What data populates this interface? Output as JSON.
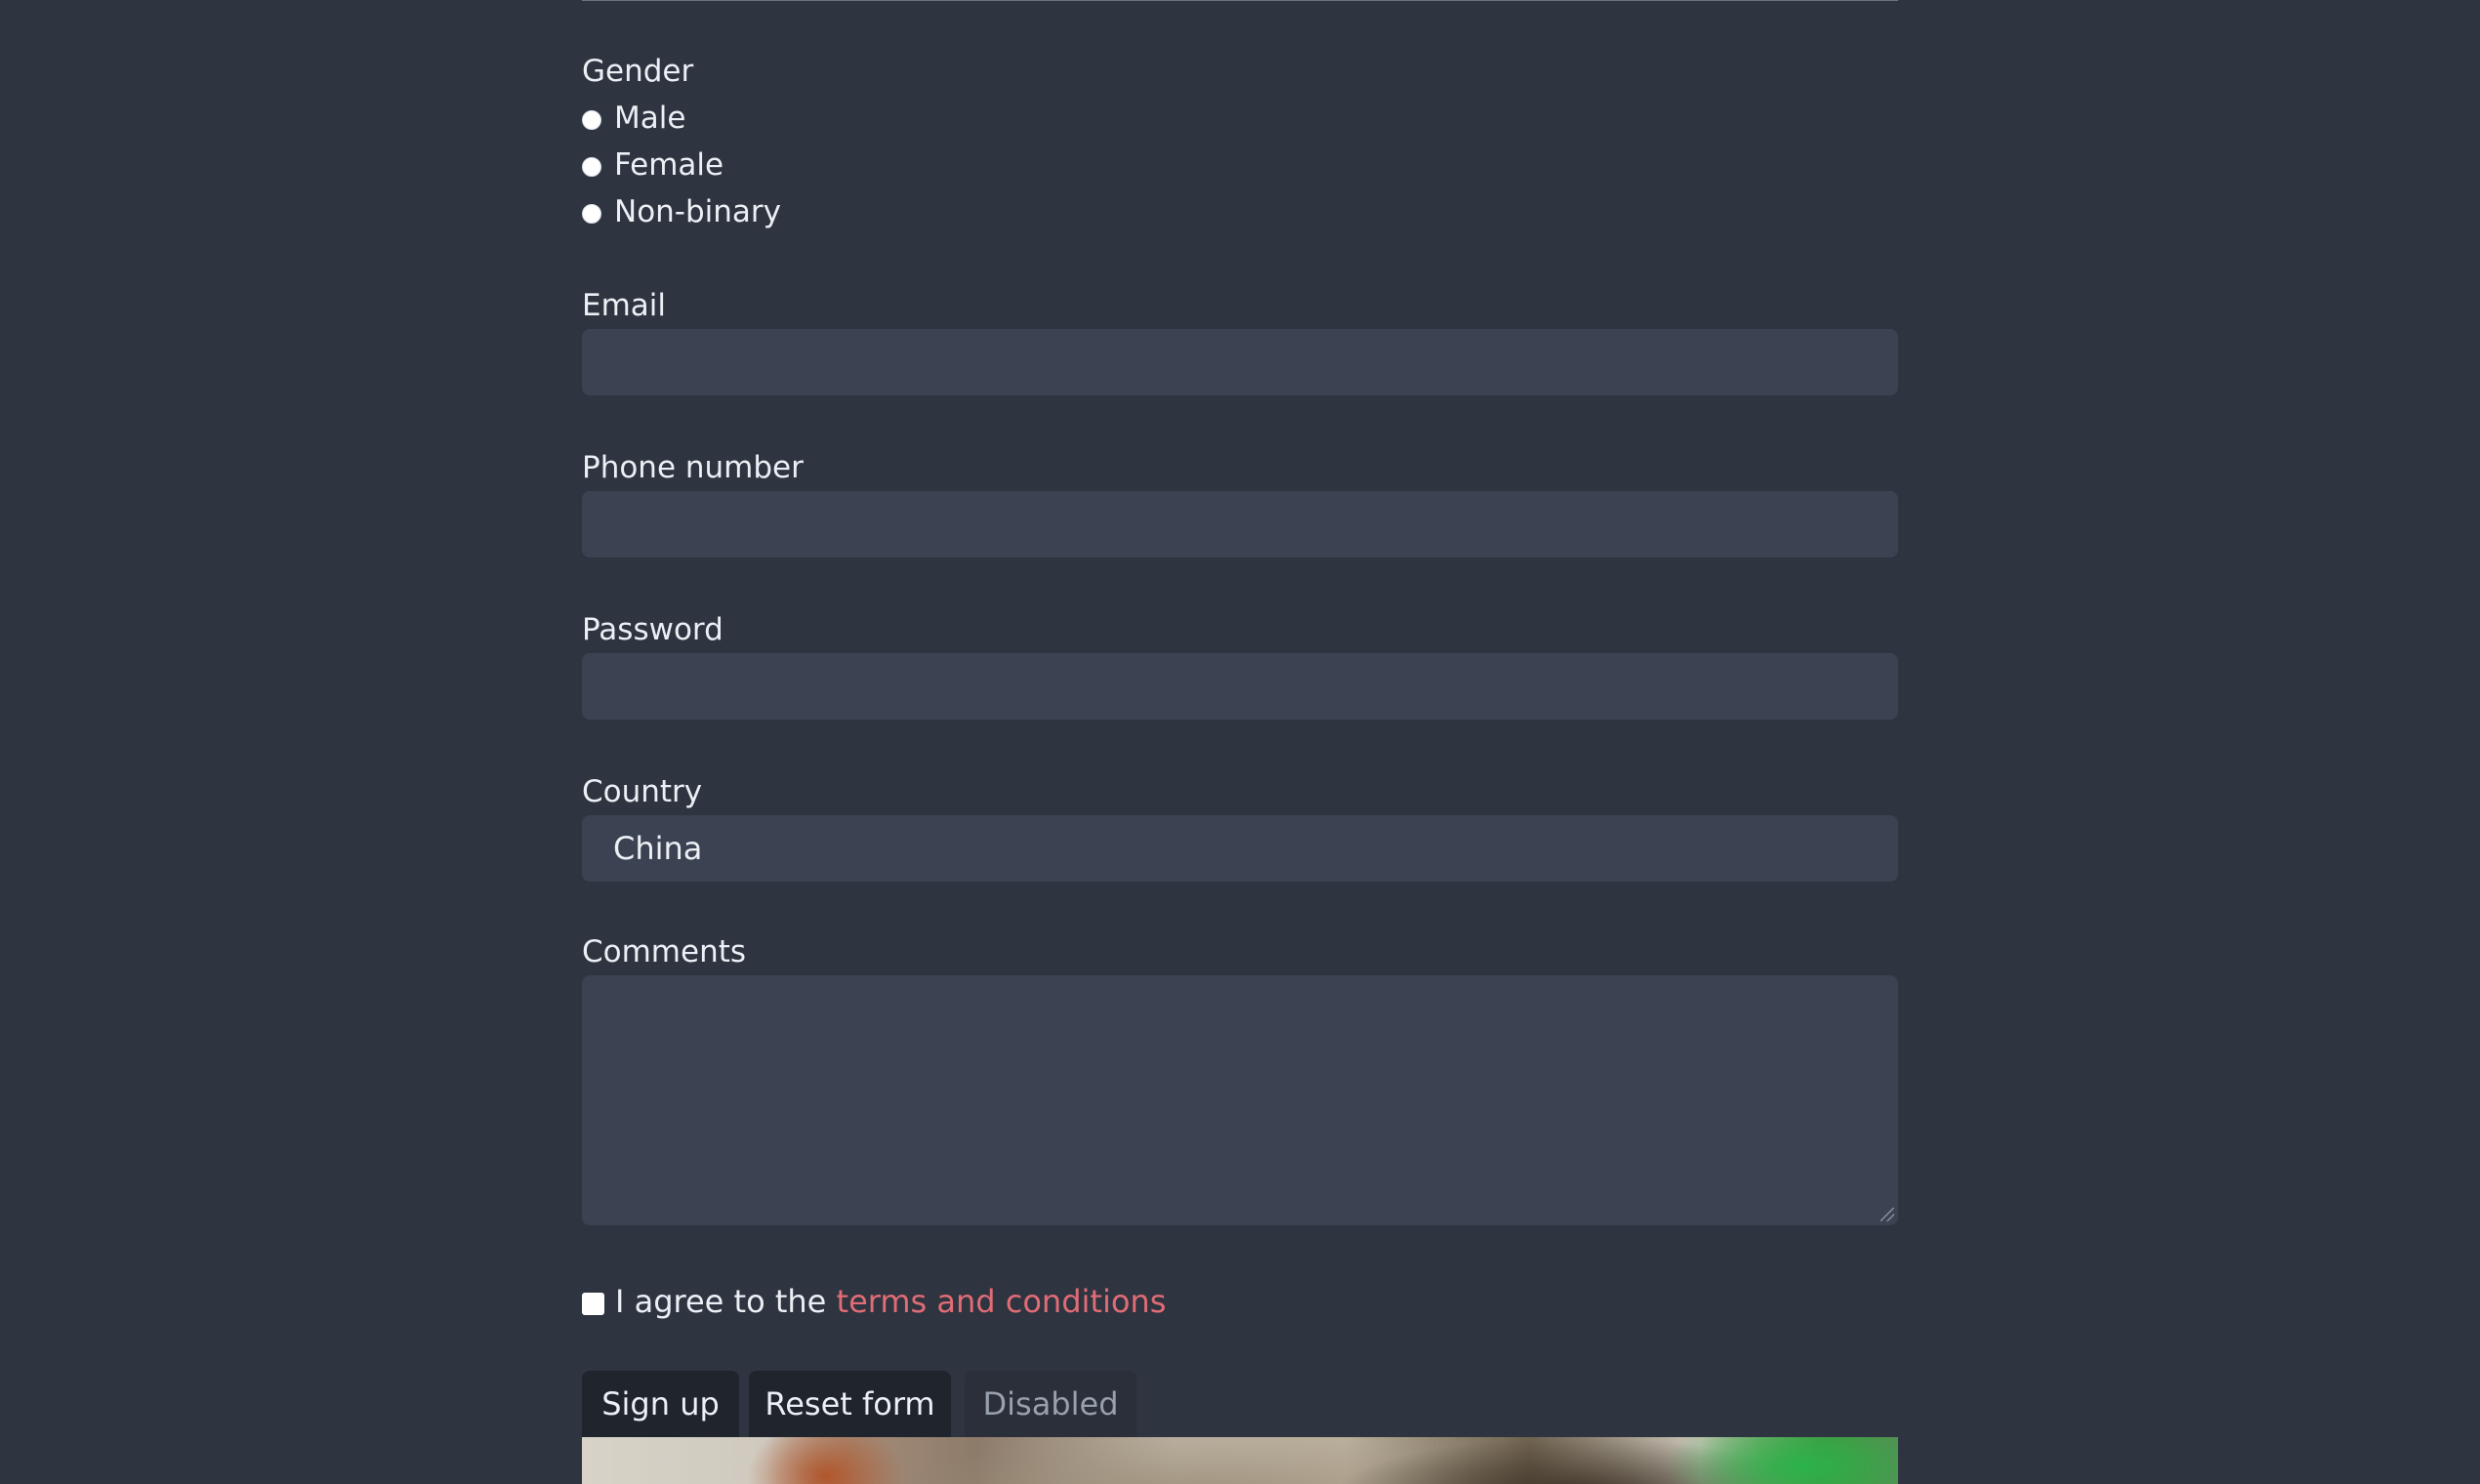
{
  "form": {
    "gender": {
      "label": "Gender",
      "options": [
        "Male",
        "Female",
        "Non-binary"
      ]
    },
    "email": {
      "label": "Email",
      "value": "",
      "placeholder": ""
    },
    "phone": {
      "label": "Phone number",
      "value": "",
      "placeholder": ""
    },
    "password": {
      "label": "Password",
      "value": "",
      "placeholder": ""
    },
    "country": {
      "label": "Country",
      "selected": "China"
    },
    "comments": {
      "label": "Comments",
      "value": ""
    },
    "agreement": {
      "text": "I agree to the ",
      "link_text": "terms and conditions"
    },
    "buttons": {
      "signup": "Sign up",
      "reset": "Reset form",
      "disabled": "Disabled"
    }
  },
  "colors": {
    "background": "#2e3440",
    "field_background": "#3b4252",
    "text": "#eceff4",
    "link": "#e06c75",
    "button_background": "#1f242d"
  }
}
